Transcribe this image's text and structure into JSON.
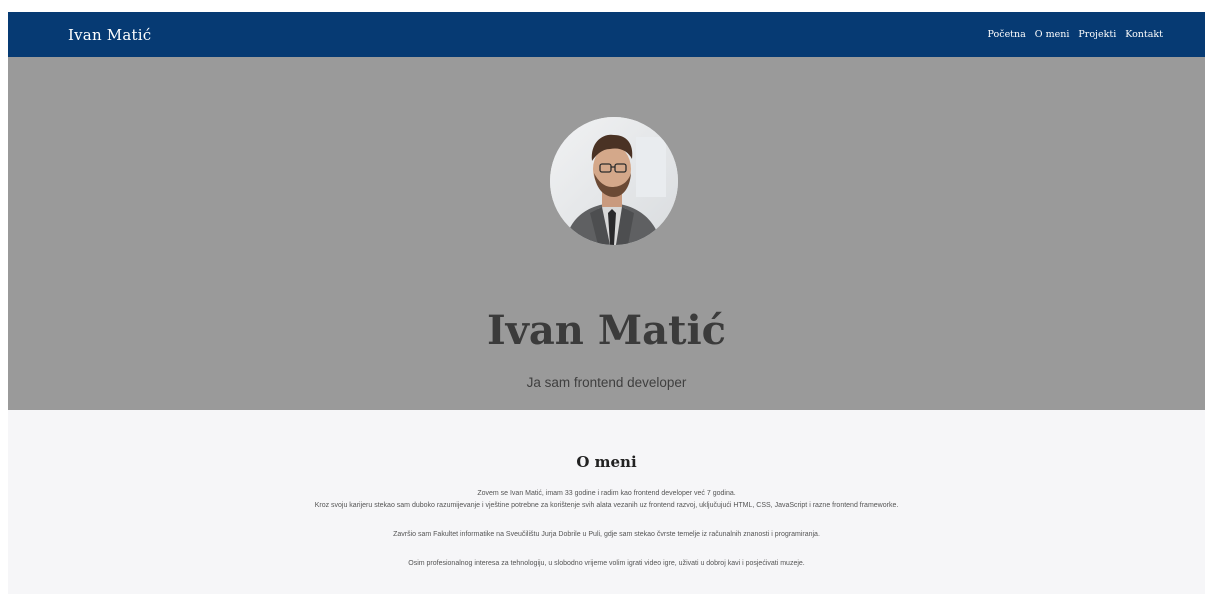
{
  "nav": {
    "brand": "Ivan Matić",
    "links": [
      "Početna",
      "O meni",
      "Projekti",
      "Kontakt"
    ]
  },
  "hero": {
    "name": "Ivan Matić",
    "subtitle": "Ja sam frontend developer",
    "avatar_alt": "Profilna fotografija"
  },
  "about": {
    "title": "O meni",
    "paragraphs": [
      "Zovem se Ivan Matić, imam 33 godine i radim kao frontend developer već 7 godina.",
      "Kroz svoju karijeru stekao sam duboko razumijevanje i vještine potrebne za korištenje svih alata vezanih uz frontend razvoj, uključujući HTML, CSS, JavaScript i razne frontend frameworke.",
      "Završio sam Fakultet informatike na Sveučilištu Jurja Dobrile u Puli, gdje sam stekao čvrste temelje iz računalnih znanosti i programiranja.",
      "Osim profesionalnog interesa za tehnologiju, u slobodno vrijeme volim igrati video igre, uživati u dobroj kavi i posjećivati muzeje."
    ]
  },
  "colors": {
    "navbar": "#063a73",
    "hero_bg": "#9a9a9a",
    "page_bg": "#f6f6f8"
  }
}
